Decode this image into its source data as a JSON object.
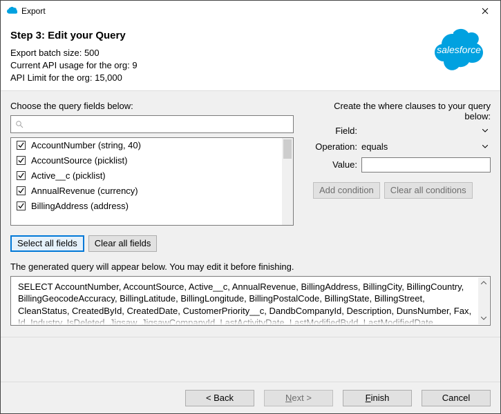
{
  "window": {
    "title": "Export"
  },
  "header": {
    "step_title": "Step 3: Edit your Query",
    "batch_label": "Export batch size: 500",
    "api_usage_label": "Current API usage for the org: 9",
    "api_limit_label": "API Limit for the org: 15,000",
    "logo_text": "salesforce"
  },
  "left": {
    "section_label": "Choose the query fields below:",
    "search_placeholder": "",
    "fields": [
      {
        "label": "AccountNumber (string, 40)",
        "checked": true
      },
      {
        "label": "AccountSource (picklist)",
        "checked": true
      },
      {
        "label": "Active__c (picklist)",
        "checked": true
      },
      {
        "label": "AnnualRevenue (currency)",
        "checked": true
      },
      {
        "label": "BillingAddress (address)",
        "checked": true
      }
    ],
    "select_all_label": "Select all fields",
    "clear_all_label": "Clear all fields"
  },
  "right": {
    "section_label": "Create the where clauses to your query below:",
    "field_label": "Field:",
    "operation_label": "Operation:",
    "operation_value": "equals",
    "value_label": "Value:",
    "value_text": "",
    "add_condition_label": "Add condition",
    "clear_conditions_label": "Clear all conditions"
  },
  "generated": {
    "label": "The generated query will appear below.  You may edit it before finishing.",
    "query": "SELECT AccountNumber, AccountSource, Active__c, AnnualRevenue, BillingAddress, BillingCity, BillingCountry, BillingGeocodeAccuracy, BillingLatitude, BillingLongitude, BillingPostalCode, BillingState, BillingStreet, CleanStatus, CreatedById, CreatedDate, CustomerPriority__c, DandbCompanyId, Description, DunsNumber, Fax, Id, Industry, IsDeleted, Jigsaw, JigsawCompanyId, LastActivityDate, LastModifiedById, LastModifiedDate,"
  },
  "footer": {
    "back": "< Back",
    "next": "Next >",
    "finish": "Finish",
    "cancel": "Cancel"
  }
}
